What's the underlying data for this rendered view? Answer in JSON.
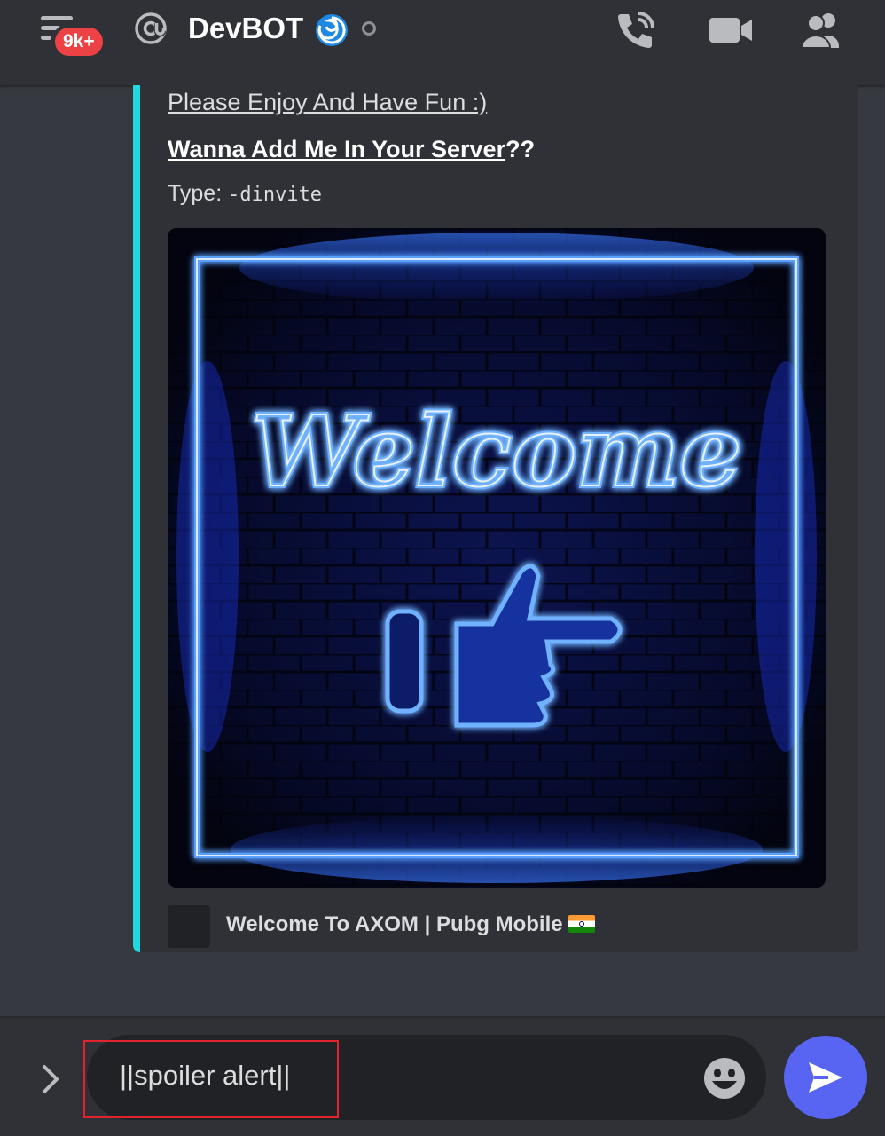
{
  "header": {
    "notification_badge": "9k+",
    "channel_title": "DevBOT"
  },
  "embed": {
    "line1": "Please Enjoy And Have Fun :)",
    "line2_link": "Wanna Add Me In Your Server",
    "line2_suffix": "??",
    "line3_label": "Type: ",
    "line3_code": "-dinvite",
    "image_text": "Welcome",
    "footer_text": "Welcome To AXOM | Pubg Mobile",
    "accent_color": "#1fd8e0"
  },
  "composer": {
    "message_value": "||spoiler alert||",
    "send_color": "#5865f2",
    "highlight_color": "#e0232c"
  }
}
